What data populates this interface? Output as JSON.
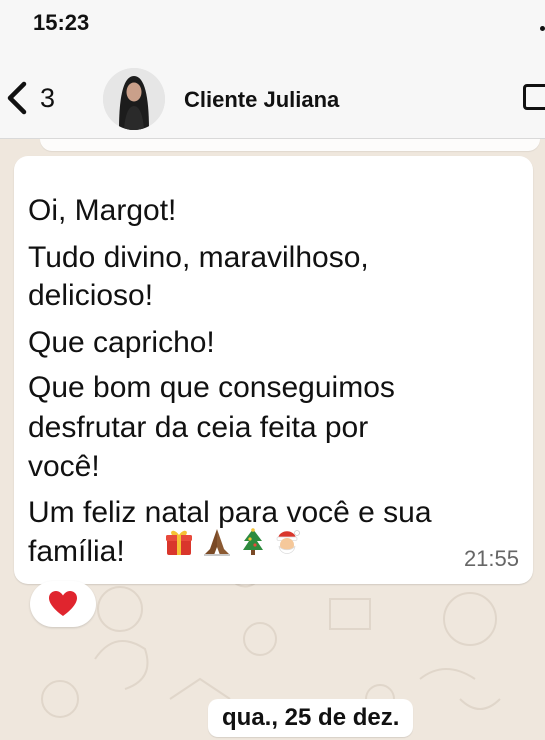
{
  "status_bar": {
    "time": "15:23"
  },
  "header": {
    "unread_count": "3",
    "contact_name": "Cliente Juliana"
  },
  "message": {
    "lines": [
      "Oi, Margot!",
      "Tudo divino, maravilhoso,",
      "delicioso!",
      "Que capricho!",
      "Que bom que conseguimos",
      "desfrutar da ceia feita por",
      "você!",
      "Um feliz natal para você e sua",
      "família!"
    ],
    "emojis": [
      "gift-emoji",
      "folded-hands-emoji",
      "christmas-tree-emoji",
      "santa-emoji"
    ],
    "time": "21:55",
    "reaction": "heart-emoji"
  },
  "date_separator": "qua., 25 de dez.",
  "colors": {
    "chat_background": "#efe7dd",
    "bubble": "#ffffff",
    "header": "#f7f7f7",
    "heart": "#e0252e"
  }
}
